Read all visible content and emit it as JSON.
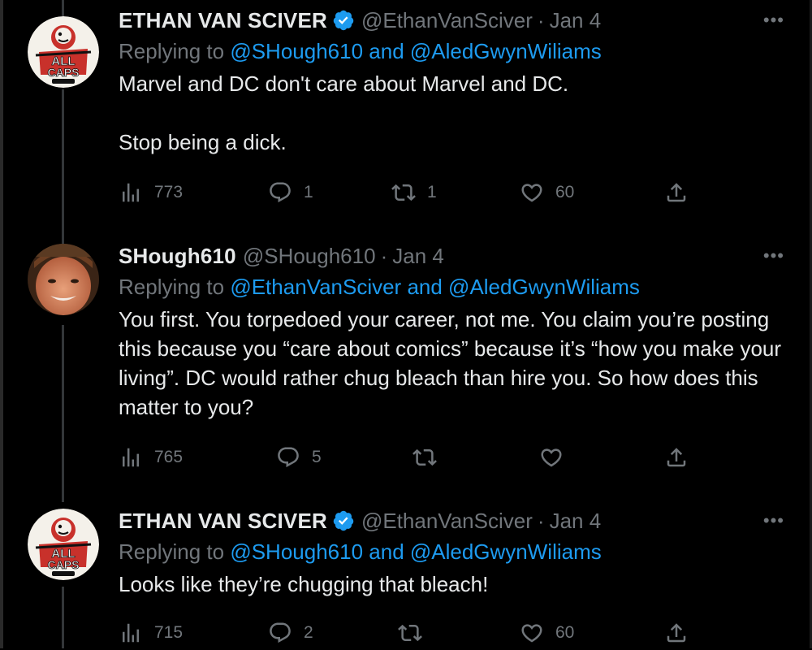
{
  "tweets": [
    {
      "name": "ETHAN VAN SCIVER",
      "verified": true,
      "handle": "@EthanVanSciver",
      "separator": "·",
      "date": "Jan 4",
      "replying_label": "Replying to",
      "replying_to": "@SHough610 and @AledGwynWiliams",
      "text": "Marvel and DC don't care about Marvel and DC.\n\nStop being a dick.",
      "more": "•••",
      "avatar": "all-caps-comics-logo",
      "stats": {
        "views": "773",
        "replies": "1",
        "retweets": "1",
        "likes": "60"
      }
    },
    {
      "name": "SHough610",
      "verified": false,
      "handle": "@SHough610",
      "separator": "·",
      "date": "Jan 4",
      "replying_label": "Replying to",
      "replying_to": "@EthanVanSciver and @AledGwynWiliams",
      "text": "You first. You torpedoed your career, not me. You claim you’re posting this because you “care about comics” because it’s “how you make your living”. DC would rather chug bleach than hire you. So how does this matter to you?",
      "more": "•••",
      "avatar": "user-photo",
      "stats": {
        "views": "765",
        "replies": "5",
        "retweets": "",
        "likes": ""
      }
    },
    {
      "name": "ETHAN VAN SCIVER",
      "verified": true,
      "handle": "@EthanVanSciver",
      "separator": "·",
      "date": "Jan 4",
      "replying_label": "Replying to",
      "replying_to": "@SHough610 and @AledGwynWiliams",
      "text": "Looks like they’re chugging that bleach!",
      "more": "•••",
      "avatar": "all-caps-comics-logo",
      "stats": {
        "views": "715",
        "replies": "2",
        "retweets": "",
        "likes": "60"
      }
    }
  ],
  "colors": {
    "background": "#000000",
    "text": "#e7e9ea",
    "muted": "#71767b",
    "link": "#1d9bf0",
    "verified": "#1d9bf0"
  }
}
